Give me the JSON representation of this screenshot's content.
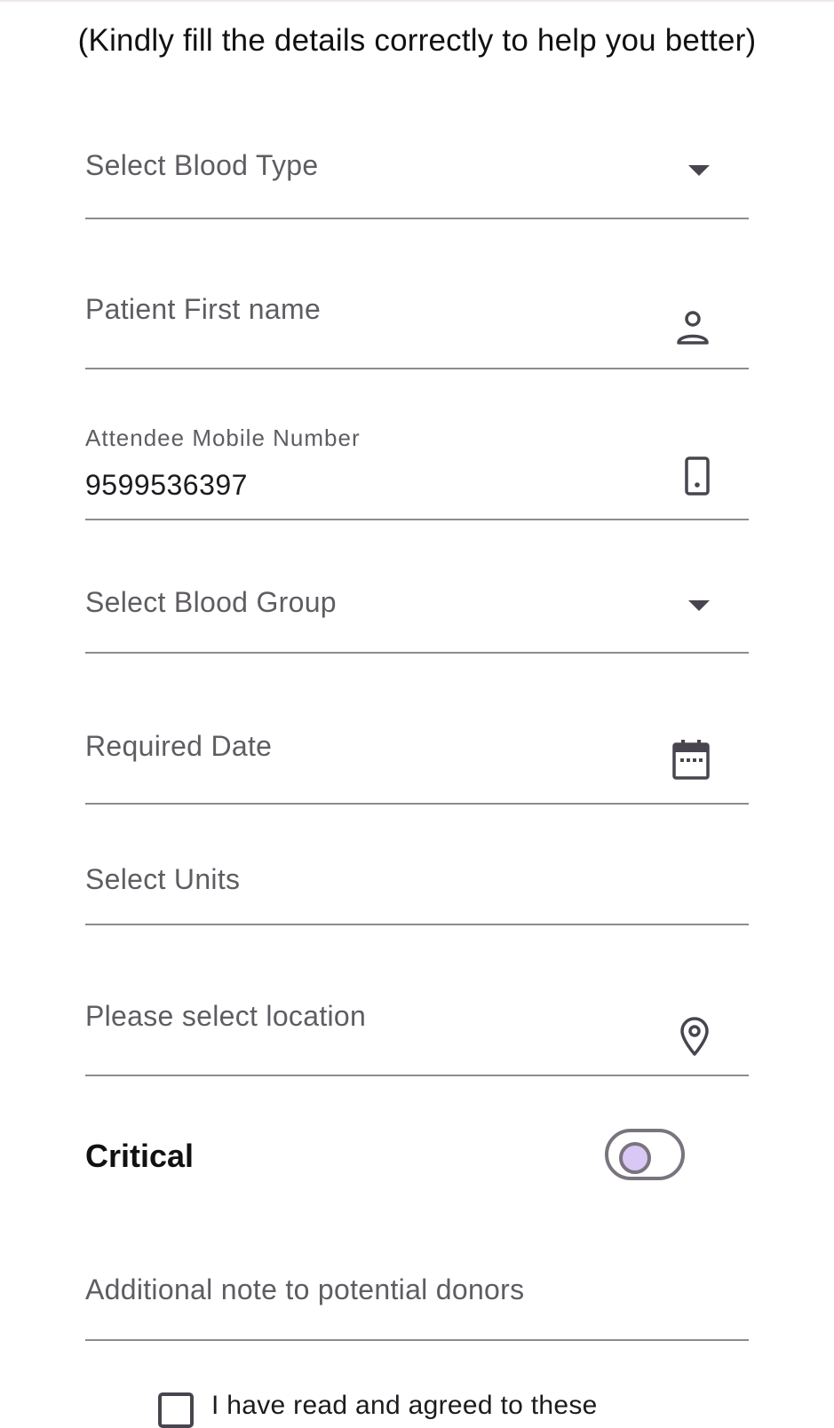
{
  "header": {
    "subtitle": "(Kindly fill the details correctly to help you better)"
  },
  "form": {
    "blood_type": {
      "placeholder": "Select Blood Type",
      "icon": "dropdown-arrow-icon"
    },
    "patient_first_name": {
      "placeholder": "Patient First name",
      "icon": "person-icon"
    },
    "attendee_mobile": {
      "label": "Attendee Mobile Number",
      "value": "9599536397",
      "icon": "phone-icon"
    },
    "blood_group": {
      "placeholder": "Select Blood Group",
      "icon": "dropdown-arrow-icon"
    },
    "required_date": {
      "placeholder": "Required Date",
      "icon": "calendar-icon"
    },
    "units": {
      "placeholder": "Select Units"
    },
    "location": {
      "placeholder": "Please select location",
      "icon": "location-pin-icon"
    },
    "critical": {
      "label": "Critical",
      "on": false
    },
    "note": {
      "placeholder": "Additional note to potential donors"
    },
    "agreement": {
      "text": "I have read and agreed to these",
      "checked": false
    }
  },
  "colors": {
    "underline": "#8d8a90",
    "label": "#5f5c62",
    "icon": "#49454f",
    "switch_thumb": "#d9c8f5",
    "switch_outline": "#79747e"
  }
}
